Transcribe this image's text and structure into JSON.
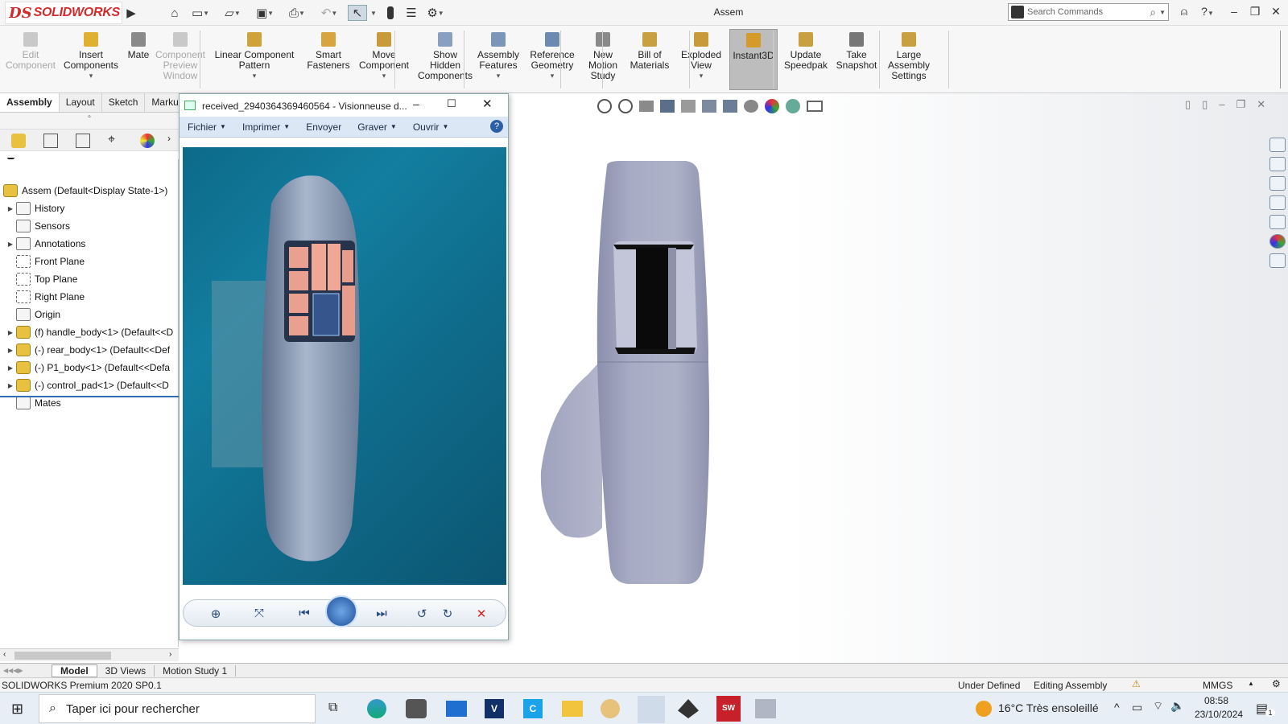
{
  "app": {
    "logo_ds": "DS",
    "logo_name": "SOLIDWORKS",
    "title": "Assem"
  },
  "search": {
    "placeholder": "Search Commands"
  },
  "ribbon": [
    {
      "label": "Edit\nComponent",
      "disabled": true
    },
    {
      "label": "Insert\nComponents"
    },
    {
      "label": "Mate"
    },
    {
      "label": "Component\nPreview\nWindow",
      "disabled": true
    },
    {
      "label": "Linear Component\nPattern"
    },
    {
      "label": "Smart\nFasteners"
    },
    {
      "label": "Move\nComponent"
    },
    {
      "label": "Show\nHidden\nComponents"
    },
    {
      "label": "Assembly\nFeatures"
    },
    {
      "label": "Reference\nGeometry"
    },
    {
      "label": "New\nMotion\nStudy"
    },
    {
      "label": "Bill of\nMaterials"
    },
    {
      "label": "Exploded\nView"
    },
    {
      "label": "Instant3D",
      "active": true
    },
    {
      "label": "Update\nSpeedpak"
    },
    {
      "label": "Take\nSnapshot"
    },
    {
      "label": "Large\nAssembly\nSettings"
    }
  ],
  "tabs": [
    "Assembly",
    "Layout",
    "Sketch",
    "Marku"
  ],
  "tree": {
    "root": "Assem  (Default<Display State-1>)",
    "items": [
      {
        "label": "History",
        "expand": true
      },
      {
        "label": "Sensors"
      },
      {
        "label": "Annotations",
        "expand": true
      },
      {
        "label": "Front Plane"
      },
      {
        "label": "Top Plane"
      },
      {
        "label": "Right Plane"
      },
      {
        "label": "Origin"
      },
      {
        "label": "(f) handle_body<1> (Default<<D",
        "expand": true,
        "part": true
      },
      {
        "label": "(-) rear_body<1> (Default<<Def",
        "expand": true,
        "part": true
      },
      {
        "label": "(-) P1_body<1> (Default<<Defa",
        "expand": true,
        "part": true
      },
      {
        "label": "(-) control_pad<1> (Default<<D",
        "expand": true,
        "part": true
      },
      {
        "label": "Mates"
      }
    ]
  },
  "viewer": {
    "title": "received_2940364369460564 - Visionneuse d...",
    "menu": [
      "Fichier",
      "Imprimer",
      "Envoyer",
      "Graver",
      "Ouvrir"
    ],
    "menu_has_dropdown": [
      true,
      true,
      false,
      true,
      true
    ]
  },
  "bottom_tabs": [
    "Model",
    "3D Views",
    "Motion Study 1"
  ],
  "status": {
    "product": "SOLIDWORKS Premium 2020 SP0.1",
    "state": "Under Defined",
    "mode": "Editing Assembly",
    "units": "MMGS"
  },
  "taskbar": {
    "search_placeholder": "Taper ici pour rechercher",
    "weather": "16°C  Très ensoleillé",
    "time": "08:58",
    "date": "23/10/2024",
    "notif_count": "1"
  },
  "colors": {
    "brand_red": "#d42a2a",
    "model_grey": "#9da2b8",
    "viewer_menu": "#dbe7f5"
  }
}
